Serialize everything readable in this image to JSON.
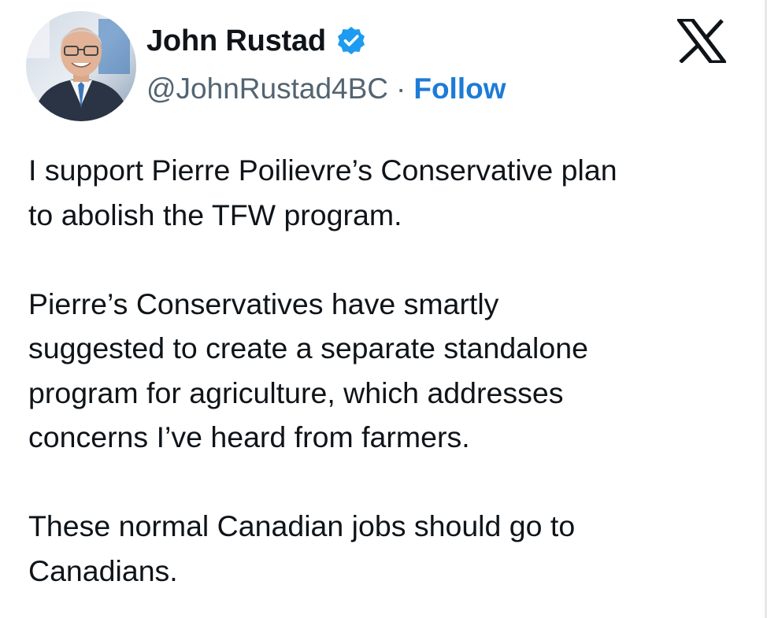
{
  "author": {
    "display_name": "John Rustad",
    "handle": "@JohnRustad4BC",
    "separator": "·",
    "follow_label": "Follow",
    "avatar_icon": "profile-photo",
    "verified_icon": "verified-badge-icon"
  },
  "brand": {
    "logo_icon": "x-logo-icon"
  },
  "tweet": {
    "paragraphs": [
      "I support Pierre Poilievre’s Conservative plan\nto abolish the TFW program.",
      "Pierre’s Conservatives have smartly\nsuggested to create a separate standalone\nprogram for agriculture, which addresses\nconcerns I’ve heard from farmers.",
      "These normal Canadian jobs should go to\nCanadians."
    ]
  },
  "colors": {
    "text": "#0f1419",
    "secondary": "#536471",
    "accent": "#1d7bd8",
    "verified": "#1d9bf0"
  }
}
